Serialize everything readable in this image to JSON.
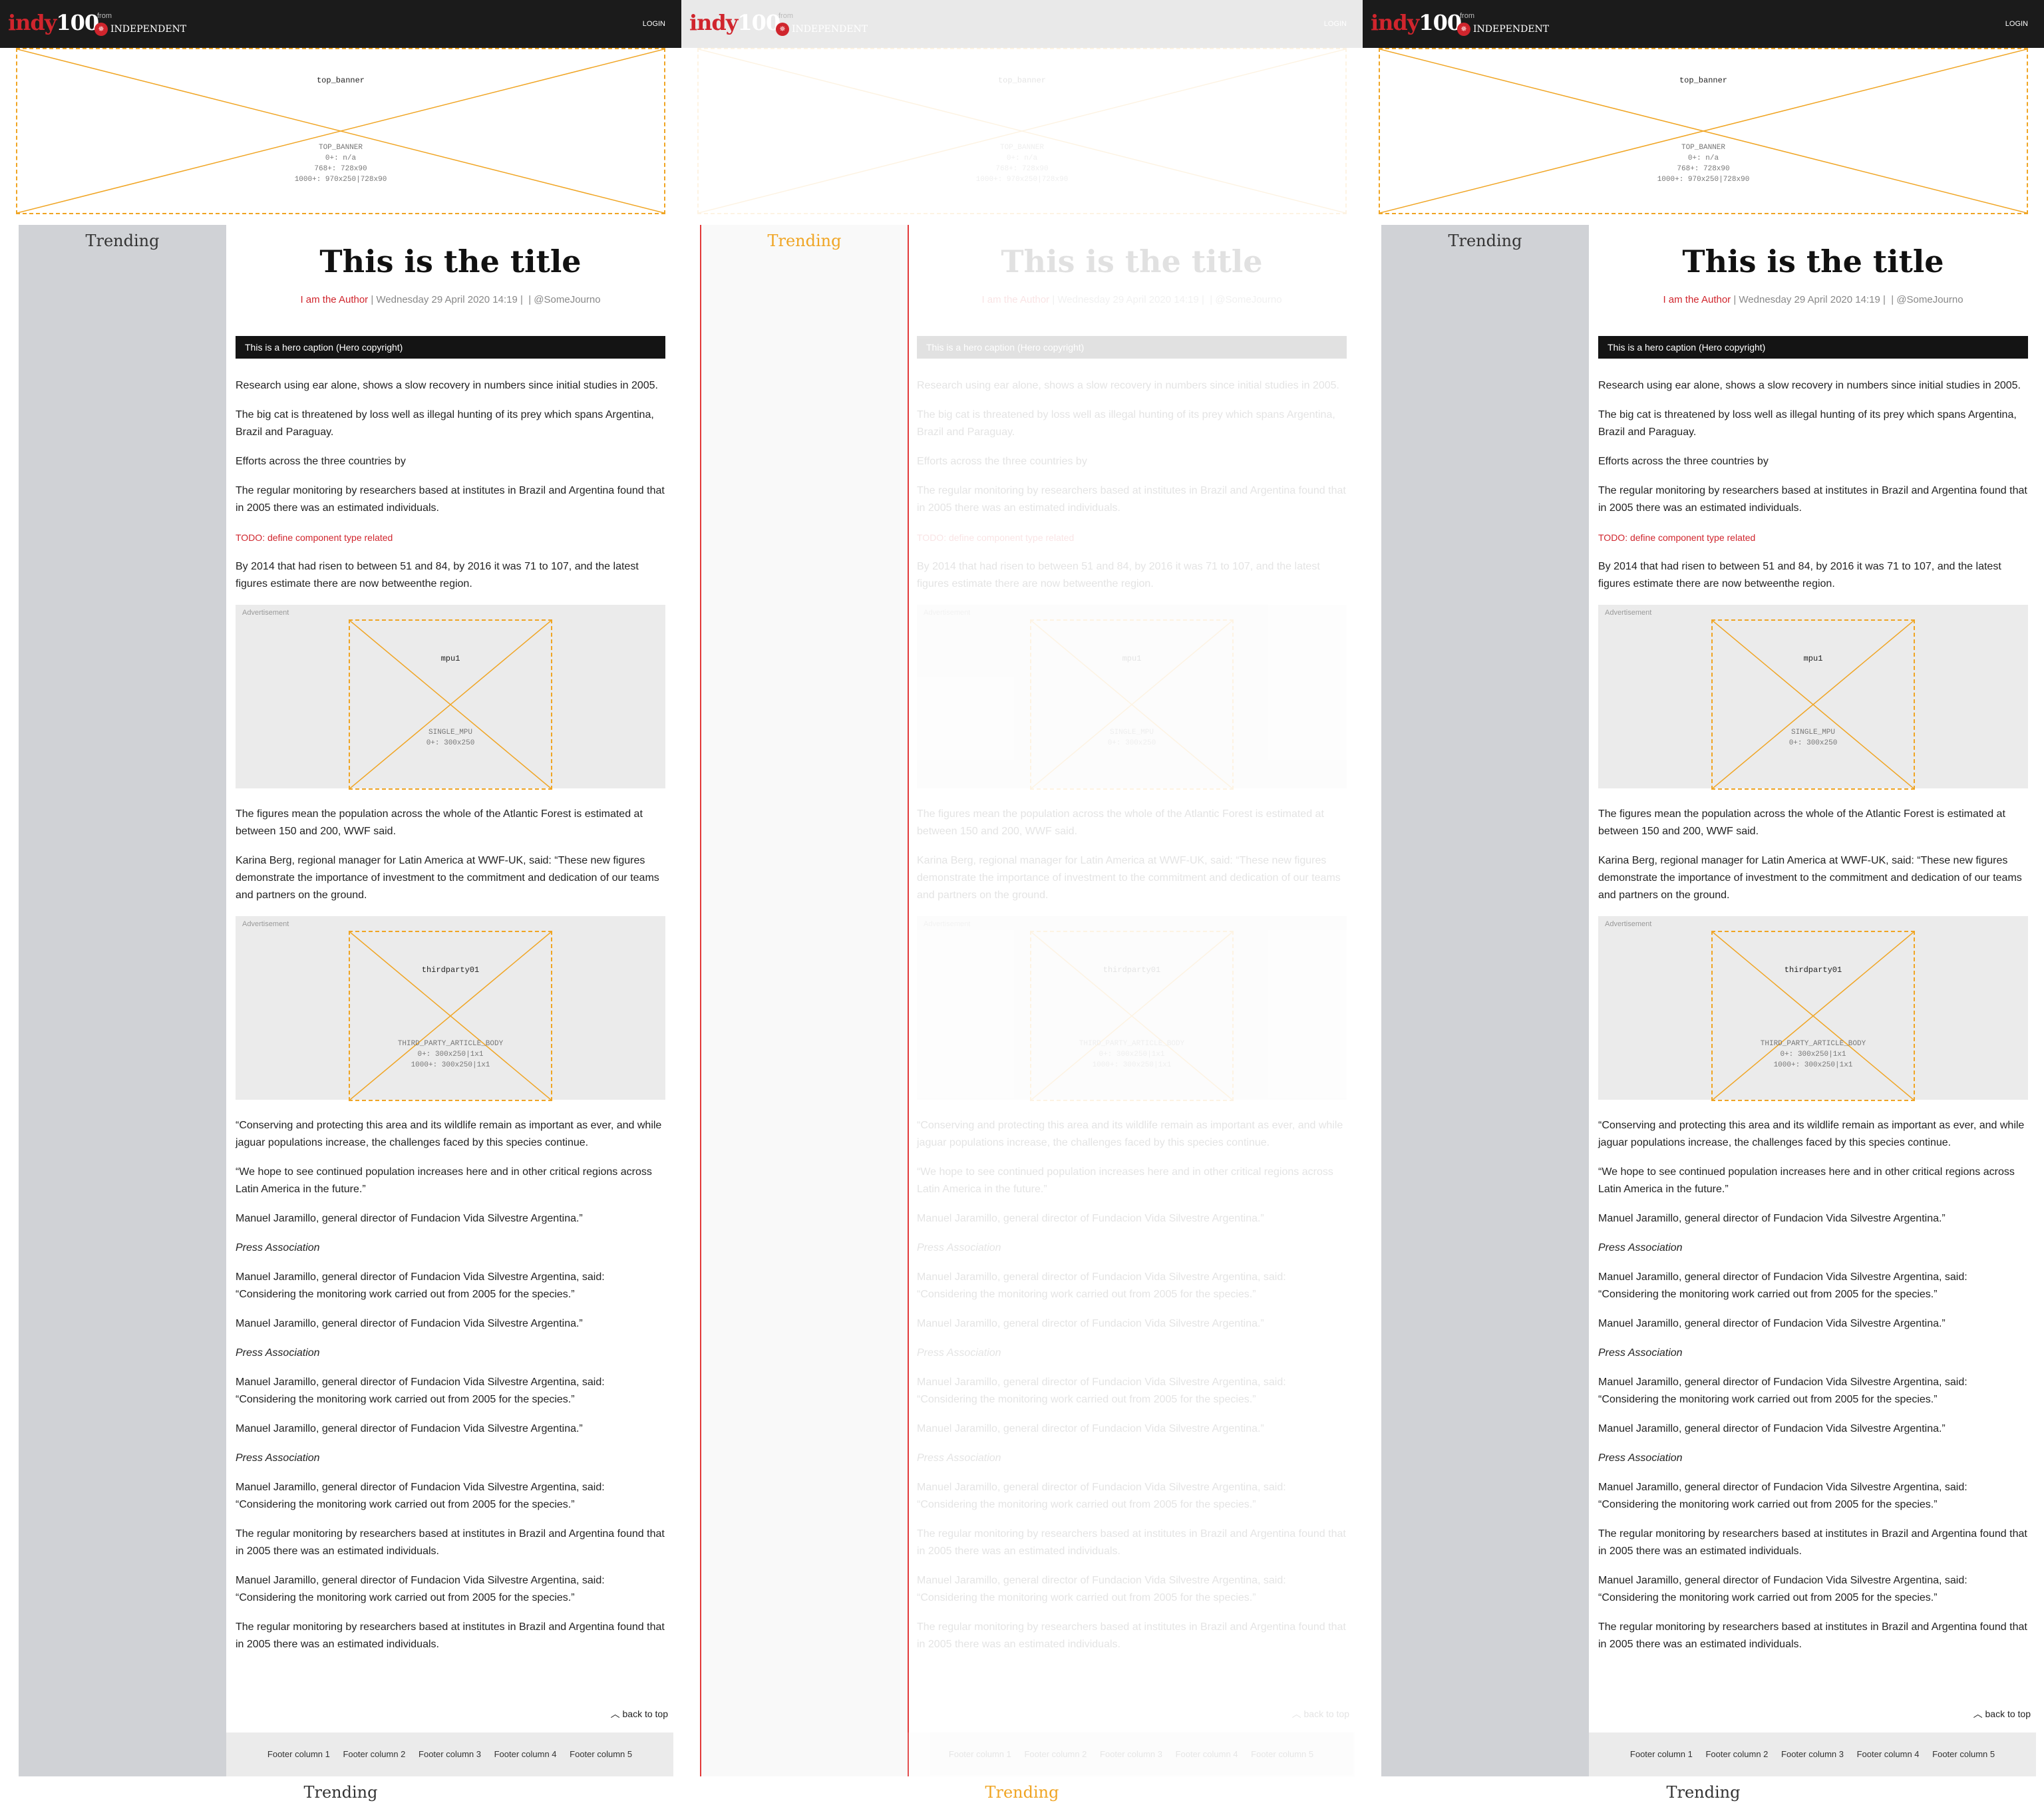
{
  "header": {
    "logo_part1": "indy",
    "logo_part2": "100",
    "from_text": "from",
    "eagle_glyph": "✵",
    "publisher": "INDEPENDENT",
    "login_label": "LOGIN"
  },
  "banner": {
    "slot_name": "top_banner",
    "info_lines": [
      "TOP_BANNER",
      "0+: n/a",
      "768+: 728x90",
      "1000+: 970x250|728x90"
    ]
  },
  "sidebar": {
    "title": "Trending"
  },
  "article": {
    "title": "This is the title",
    "author": "I am the Author",
    "date": "Wednesday 29 April 2020 14:19",
    "twitter": "@SomeJourno",
    "hero_caption": "This is a hero caption (Hero copyright)",
    "paragraphs_top": [
      "Research using ear alone, shows a slow recovery in numbers since initial studies in 2005.",
      "The big cat is threatened by loss well as illegal hunting of its prey which spans Argentina, Brazil and Paraguay.",
      "Efforts across the three countries by",
      "The regular monitoring by researchers based at institutes in Brazil and Argentina found that in 2005 there was an estimated individuals."
    ],
    "todo": "TODO: define component type related",
    "paragraph_after_todo": "By 2014 that had risen to between 51 and 84, by 2016 it was 71 to 107, and the latest figures estimate there are now betweenthe region.",
    "ad_label": "Advertisement",
    "ad1": {
      "name": "mpu1",
      "info_lines": [
        "SINGLE_MPU",
        "0+: 300x250"
      ]
    },
    "paragraphs_mid": [
      "The figures mean the population across the whole of the Atlantic Forest is estimated at between 150 and 200, WWF said.",
      "Karina Berg, regional manager for Latin America at WWF-UK, said: “These new figures demonstrate the importance of investment to the commitment and dedication of our teams and partners on the ground."
    ],
    "ad2": {
      "name": "thirdparty01",
      "info_lines": [
        "THIRD_PARTY_ARTICLE_BODY",
        "0+: 300x250|1x1",
        "1000+: 300x250|1x1"
      ]
    },
    "paragraphs_bottom": [
      "“Conserving and protecting this area and its wildlife remain as important as ever, and while jaguar populations increase, the challenges faced by this species continue.",
      "“We hope to see continued population increases here and in other critical regions across Latin America in the future.”",
      "Manuel Jaramillo, general director of Fundacion Vida Silvestre Argentina.”",
      "Press Association",
      "Manuel Jaramillo, general director of Fundacion Vida Silvestre Argentina, said: “Considering the monitoring work carried out from 2005 for the species.”",
      "Manuel Jaramillo, general director of Fundacion Vida Silvestre Argentina.”",
      "Press Association",
      "Manuel Jaramillo, general director of Fundacion Vida Silvestre Argentina, said: “Considering the monitoring work carried out from 2005 for the species.”",
      "Manuel Jaramillo, general director of Fundacion Vida Silvestre Argentina.”",
      "Press Association",
      "Manuel Jaramillo, general director of Fundacion Vida Silvestre Argentina, said: “Considering the monitoring work carried out from 2005 for the species.”",
      "The regular monitoring by researchers based at institutes in Brazil and Argentina found that in 2005 there was an estimated individuals.",
      "Manuel Jaramillo, general director of Fundacion Vida Silvestre Argentina, said: “Considering the monitoring work carried out from 2005 for the species.”",
      "The regular monitoring by researchers based at institutes in Brazil and Argentina found that in 2005 there was an estimated individuals."
    ]
  },
  "back_to_top": "back to top",
  "footer": {
    "columns": [
      "Footer column 1",
      "Footer column 2",
      "Footer column 3",
      "Footer column 4",
      "Footer column 5"
    ]
  },
  "bottom_trending": "Trending",
  "colors": {
    "brand_red": "#d0252d",
    "ad_slot_outline": "#f0a524",
    "sidebar": "#d0d2d6"
  }
}
